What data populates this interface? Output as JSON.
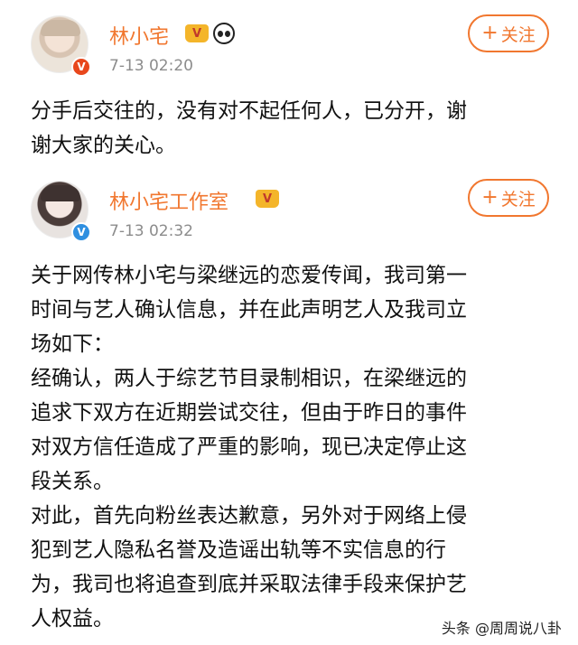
{
  "posts": [
    {
      "username": "林小宅",
      "timestamp": "7-13 02:20",
      "follow_label": "关注",
      "verify_badge": "V",
      "crown_badge": "V",
      "lines": [
        "分手后交往的，没有对不起任何人，已分开，谢",
        "谢大家的关心。"
      ]
    },
    {
      "username": "林小宅工作室",
      "timestamp": "7-13 02:32",
      "follow_label": "关注",
      "verify_badge": "V",
      "crown_badge": "V",
      "lines": [
        "关于网传林小宅与梁继远的恋爱传闻，我司第一",
        "时间与艺人确认信息，并在此声明艺人及我司立",
        "场如下：",
        "经确认，两人于综艺节目录制相识，在梁继远的",
        "追求下双方在近期尝试交往，但由于昨日的事件",
        "对双方信任造成了严重的影响，现已决定停止这",
        "段关系。",
        "对此，首先向粉丝表达歉意，另外对于网络上侵",
        "犯到艺人隐私名誉及造谣出轨等不实信息的行",
        "为，我司也将追查到底并采取法律手段来保护艺",
        "人权益。"
      ]
    }
  ],
  "watermark": "头条 @周周说八卦",
  "colors": {
    "accent": "#f1772f",
    "verify_red": "#e8471c",
    "verify_blue": "#2f8fe0",
    "timestamp": "#8c8c8c"
  }
}
